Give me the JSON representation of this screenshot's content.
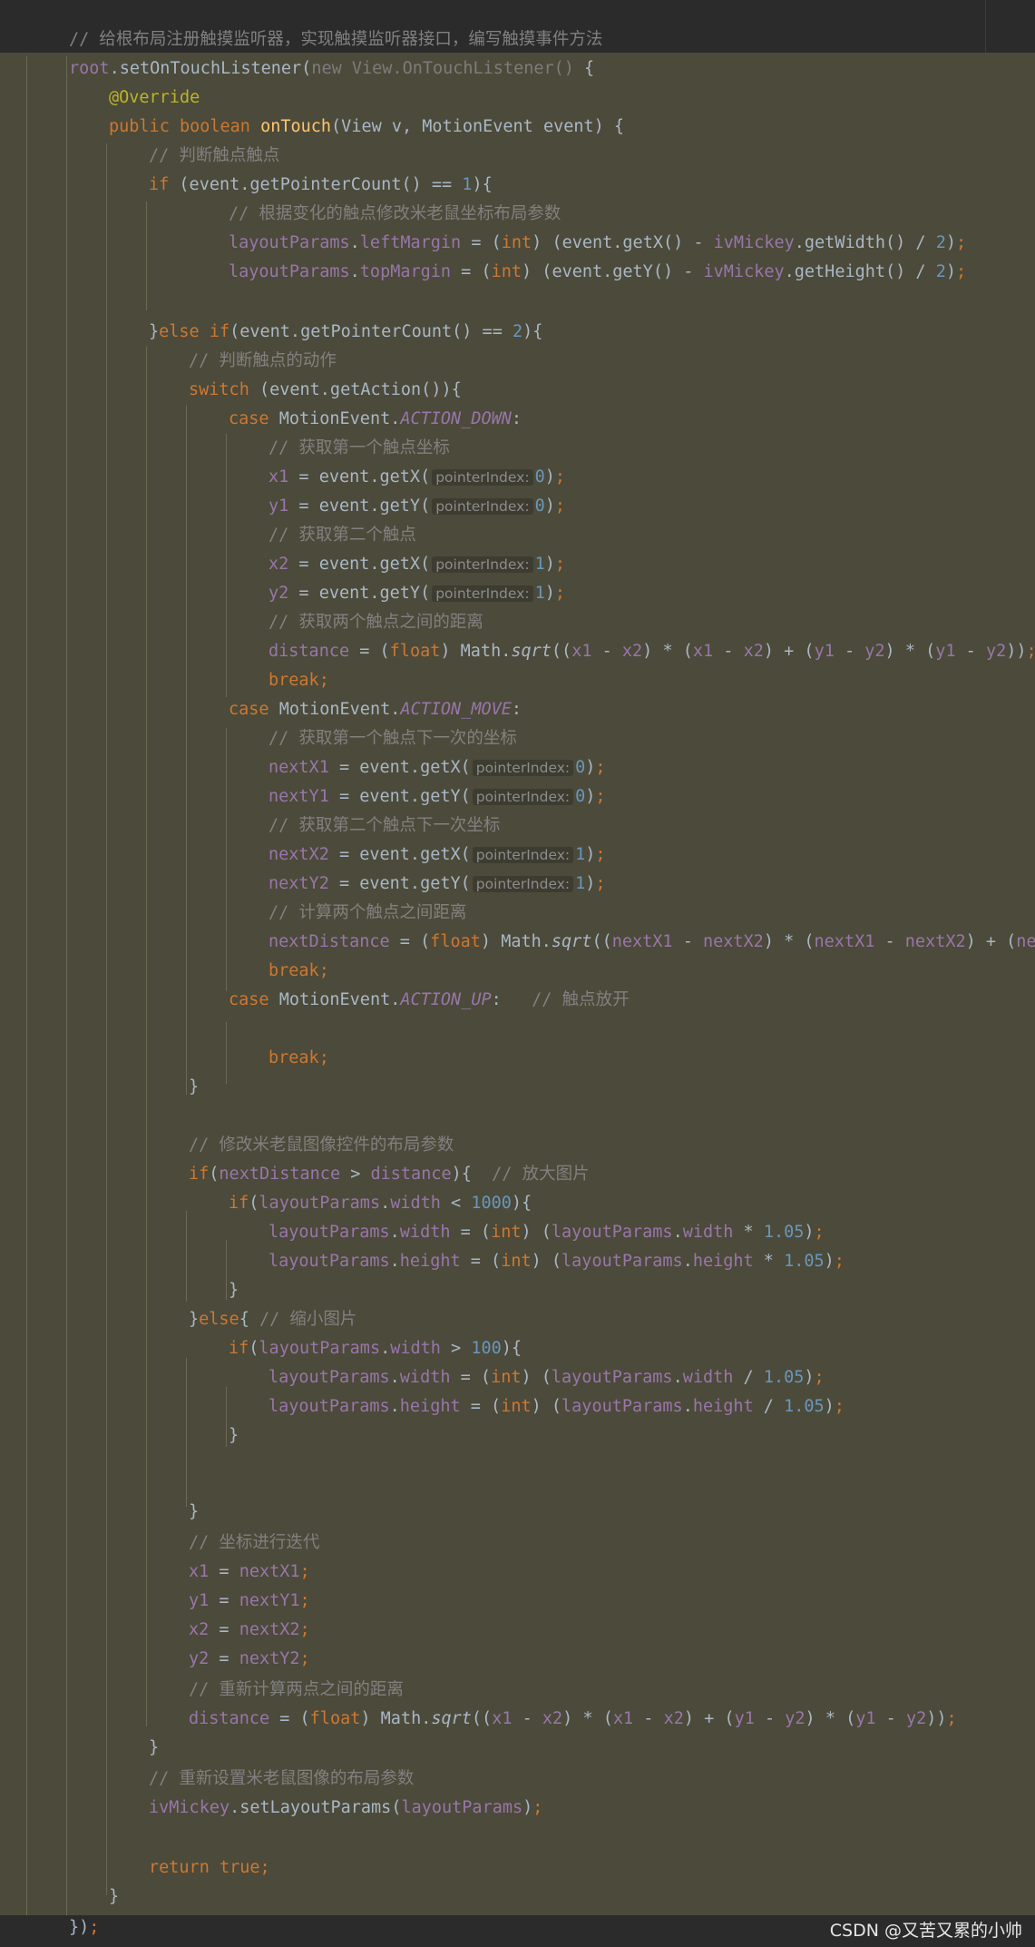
{
  "watermark": "CSDN @又苦又累的小帅",
  "code": {
    "l01": "// 给根布局注册触摸监听器，实现触摸监听器接口，编写触摸事件方法",
    "l02": {
      "a": "root",
      "b": ".setOnTouchListener(",
      "c": "new View.OnTouchListener()",
      "d": " {"
    },
    "l03": "@Override",
    "l04": {
      "a": "public boolean ",
      "b": "onTouch",
      "c": "(View v, MotionEvent event) {"
    },
    "l05": "// 判断触点触点",
    "l06": {
      "a": "if ",
      "b": "(event.getPointerCount() == ",
      "c": "1",
      "d": "){"
    },
    "l07": "// 根据变化的触点修改米老鼠坐标布局参数",
    "l08": {
      "a": "layoutParams",
      "b": ".",
      "c": "leftMargin",
      "d": " = (",
      "e": "int",
      "f": ") (event.getX() - ",
      "g": "ivMickey",
      "h": ".getWidth() / ",
      "i": "2",
      "j": ")",
      ";": ";"
    },
    "l09": {
      "a": "layoutParams",
      "b": ".",
      "c": "topMargin",
      "d": " = (",
      "e": "int",
      "f": ") (event.getY() - ",
      "g": "ivMickey",
      "h": ".getHeight() / ",
      "i": "2",
      "j": ")",
      ";": ";"
    },
    "l11": {
      "a": "}",
      "b": "else if",
      "c": "(event.getPointerCount() == ",
      "d": "2",
      "e": "){"
    },
    "l12": "// 判断触点的动作",
    "l13": {
      "a": "switch ",
      "b": "(event.getAction()){"
    },
    "l14": {
      "a": "case ",
      "b": "MotionEvent.",
      "c": "ACTION_DOWN",
      ":": ":"
    },
    "l15": "// 获取第一个触点坐标",
    "l16": {
      "a": "x1",
      "b": " = event.getX(",
      "h": "pointerIndex:",
      "n": "0",
      "e": ")",
      ";": ";"
    },
    "l17": {
      "a": "y1",
      "b": " = event.getY(",
      "h": "pointerIndex:",
      "n": "0",
      "e": ")",
      ";": ";"
    },
    "l18": "// 获取第二个触点",
    "l19": {
      "a": "x2",
      "b": " = event.getX(",
      "h": "pointerIndex:",
      "n": "1",
      "e": ")",
      ";": ";"
    },
    "l20": {
      "a": "y2",
      "b": " = event.getY(",
      "h": "pointerIndex:",
      "n": "1",
      "e": ")",
      ";": ";"
    },
    "l21": "// 获取两个触点之间的距离",
    "l22": {
      "a": "distance",
      "b": " = (",
      "c": "float",
      "d": ") Math.",
      "e": "sqrt",
      "f": "((",
      "x1": "x1",
      "m1": " - ",
      "x2": "x2",
      "g": ") * (",
      "x3": "x1",
      "m2": " - ",
      "x4": "x2",
      "h": ") + (",
      "y1": "y1",
      "m3": " - ",
      "y2": "y2",
      "i": ") * (",
      "y3": "y1",
      "m4": " - ",
      "y4": "y2",
      "j": "))",
      ";": ";"
    },
    "l23": "break;",
    "l24": {
      "a": "case ",
      "b": "MotionEvent.",
      "c": "ACTION_MOVE",
      ":": ":"
    },
    "l25": "// 获取第一个触点下一次的坐标",
    "l26": {
      "a": "nextX1",
      "b": " = event.getX(",
      "h": "pointerIndex:",
      "n": "0",
      "e": ")",
      ";": ";"
    },
    "l27": {
      "a": "nextY1",
      "b": " = event.getY(",
      "h": "pointerIndex:",
      "n": "0",
      "e": ")",
      ";": ";"
    },
    "l28": "// 获取第二个触点下一次坐标",
    "l29": {
      "a": "nextX2",
      "b": " = event.getX(",
      "h": "pointerIndex:",
      "n": "1",
      "e": ")",
      ";": ";"
    },
    "l30": {
      "a": "nextY2",
      "b": " = event.getY(",
      "h": "pointerIndex:",
      "n": "1",
      "e": ")",
      ";": ";"
    },
    "l31": "// 计算两个触点之间距离",
    "l32": {
      "a": "nextDistance",
      "b": " = (",
      "c": "float",
      "d": ") Math.",
      "e": "sqrt",
      "f": "((",
      "v1": "nextX1",
      "m1": " - ",
      "v2": "nextX2",
      "g": ") * (",
      "v3": "nextX1",
      "m2": " - ",
      "v4": "nextX2",
      "h": ") + (",
      "v5": "nex"
    },
    "l33": "break;",
    "l34": {
      "a": "case ",
      "b": "MotionEvent.",
      "c": "ACTION_UP",
      ":": ":",
      "sp": "   ",
      "com": "// 触点放开"
    },
    "l36": "break;",
    "l37": "}",
    "l39": "// 修改米老鼠图像控件的布局参数",
    "l40": {
      "a": "if",
      "b": "(",
      "c": "nextDistance",
      "d": " > ",
      "e": "distance",
      "f": "){  ",
      "com": "// 放大图片"
    },
    "l41": {
      "a": "if",
      "b": "(",
      "c": "layoutParams",
      "d": ".",
      "e": "width",
      "f": " < ",
      "n": "1000",
      "g": "){"
    },
    "l42": {
      "a": "layoutParams",
      "b": ".",
      "c": "width",
      "d": " = (",
      "e": "int",
      "f": ") (",
      "g": "layoutParams",
      "h": ".",
      "i": "width",
      "j": " * ",
      "n": "1.05",
      "k": ")",
      ";": ";"
    },
    "l43": {
      "a": "layoutParams",
      "b": ".",
      "c": "height",
      "d": " = (",
      "e": "int",
      "f": ") (",
      "g": "layoutParams",
      "h": ".",
      "i": "height",
      "j": " * ",
      "n": "1.05",
      "k": ")",
      ";": ";"
    },
    "l44": "}",
    "l45": {
      "a": "}",
      "b": "else",
      "c": "{ ",
      "com": "// 缩小图片"
    },
    "l46": {
      "a": "if",
      "b": "(",
      "c": "layoutParams",
      "d": ".",
      "e": "width",
      "f": " > ",
      "n": "100",
      "g": "){"
    },
    "l47": {
      "a": "layoutParams",
      "b": ".",
      "c": "width",
      "d": " = (",
      "e": "int",
      "f": ") (",
      "g": "layoutParams",
      "h": ".",
      "i": "width",
      "j": " / ",
      "n": "1.05",
      "k": ")",
      ";": ";"
    },
    "l48": {
      "a": "layoutParams",
      "b": ".",
      "c": "height",
      "d": " = (",
      "e": "int",
      "f": ") (",
      "g": "layoutParams",
      "h": ".",
      "i": "height",
      "j": " / ",
      "n": "1.05",
      "k": ")",
      ";": ";"
    },
    "l49": "}",
    "l51": "}",
    "l52": "// 坐标进行迭代",
    "l53": {
      "a": "x1",
      "b": " = ",
      "c": "nextX1",
      ";": ";"
    },
    "l54": {
      "a": "y1",
      "b": " = ",
      "c": "nextY1",
      ";": ";"
    },
    "l55": {
      "a": "x2",
      "b": " = ",
      "c": "nextX2",
      ";": ";"
    },
    "l56": {
      "a": "y2",
      "b": " = ",
      "c": "nextY2",
      ";": ";"
    },
    "l57": "// 重新计算两点之间的距离",
    "l58": {
      "a": "distance",
      "b": " = (",
      "c": "float",
      "d": ") Math.",
      "e": "sqrt",
      "f": "((",
      "x1": "x1",
      "m1": " - ",
      "x2": "x2",
      "g": ") * (",
      "x3": "x1",
      "m2": " - ",
      "x4": "x2",
      "h": ") + (",
      "y1": "y1",
      "m3": " - ",
      "y2": "y2",
      "i": ") * (",
      "y3": "y1",
      "m4": " - ",
      "y4": "y2",
      "j": "))",
      ";": ";"
    },
    "l59": "}",
    "l60": "// 重新设置米老鼠图像的布局参数",
    "l61": {
      "a": "ivMickey",
      "b": ".setLayoutParams(",
      "c": "layoutParams",
      "d": ")",
      ";": ";"
    },
    "l63": {
      "a": "return true",
      ";": ";"
    },
    "l64": "}",
    "l65": {
      "a": "})",
      ";": ";"
    }
  }
}
